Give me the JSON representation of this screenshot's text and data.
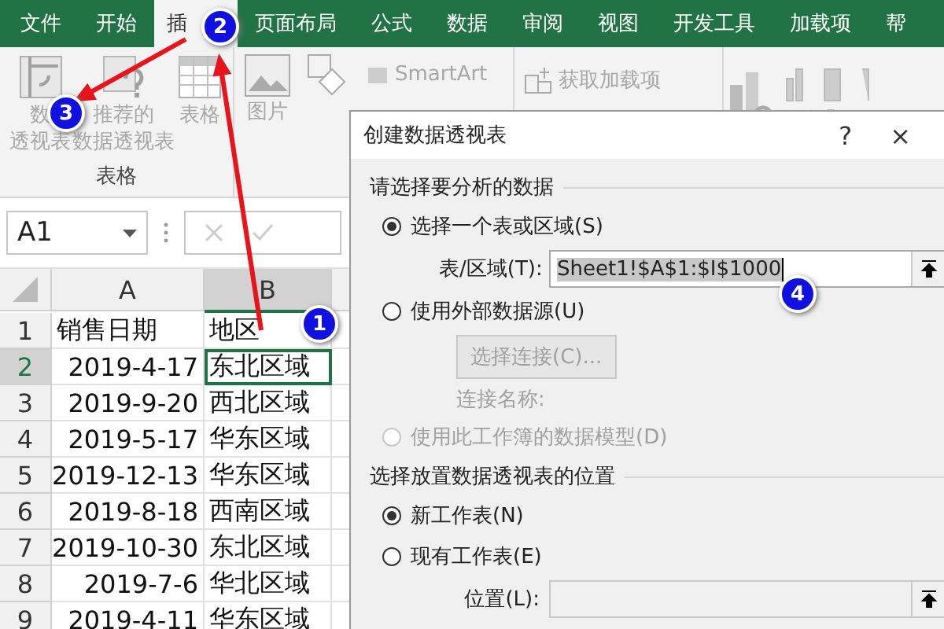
{
  "tabs": [
    {
      "label": "文件",
      "selected": false
    },
    {
      "label": "开始",
      "selected": false
    },
    {
      "label": "插",
      "selected": true
    },
    {
      "label": "页面布局",
      "selected": false
    },
    {
      "label": "公式",
      "selected": false
    },
    {
      "label": "数据",
      "selected": false
    },
    {
      "label": "审阅",
      "selected": false
    },
    {
      "label": "视图",
      "selected": false
    },
    {
      "label": "开发工具",
      "selected": false
    },
    {
      "label": "加载项",
      "selected": false
    },
    {
      "label": "帮",
      "selected": false
    }
  ],
  "ribbon": {
    "table_group": {
      "label": "表格",
      "buttons": [
        {
          "kind": "pivot",
          "lines": [
            "数",
            "透视表"
          ]
        },
        {
          "kind": "recommend",
          "lines": [
            "推荐的",
            "数据透视表"
          ]
        },
        {
          "kind": "table",
          "lines": [
            "表格"
          ]
        }
      ]
    },
    "picture": {
      "label": "图片"
    },
    "smartart": "SmartArt",
    "addins": "获取加载项"
  },
  "name_box": "A1",
  "columns": [
    "A",
    "B"
  ],
  "rows": [
    {
      "num": "1",
      "cells": [
        "销售日期",
        "地区"
      ],
      "selected": false
    },
    {
      "num": "2",
      "cells": [
        "2019-4-17",
        "东北区域"
      ],
      "selected": true
    },
    {
      "num": "3",
      "cells": [
        "2019-9-20",
        "西北区域"
      ],
      "selected": false
    },
    {
      "num": "4",
      "cells": [
        "2019-5-17",
        "华东区域"
      ],
      "selected": false
    },
    {
      "num": "5",
      "cells": [
        "2019-12-13",
        "华东区域"
      ],
      "selected": false
    },
    {
      "num": "6",
      "cells": [
        "2019-8-18",
        "西南区域"
      ],
      "selected": false
    },
    {
      "num": "7",
      "cells": [
        "2019-10-30",
        "东北区域"
      ],
      "selected": false
    },
    {
      "num": "8",
      "cells": [
        "2019-7-6",
        "华北区域"
      ],
      "selected": false
    },
    {
      "num": "9",
      "cells": [
        "2019-4-11",
        "华东区域"
      ],
      "selected": false
    }
  ],
  "dialog": {
    "title": "创建数据透视表",
    "help": "?",
    "close": "×",
    "items": [
      {
        "kind": "section",
        "label": "请选择要分析的数据"
      },
      {
        "kind": "radio",
        "label": "选择一个表或区域(S)",
        "selected": true,
        "disabled": false
      },
      {
        "kind": "field",
        "label": "表/区域(T):",
        "value": "Sheet1!$A$1:$I$1000",
        "disabled": false
      },
      {
        "kind": "radio",
        "label": "使用外部数据源(U)",
        "selected": false,
        "disabled": false
      },
      {
        "kind": "button",
        "label": "选择连接(C)...",
        "disabled": true
      },
      {
        "kind": "note",
        "label": "连接名称:",
        "disabled": true
      },
      {
        "kind": "radio",
        "label": "使用此工作簿的数据模型(D)",
        "selected": false,
        "disabled": true
      },
      {
        "kind": "section",
        "label": "选择放置数据透视表的位置"
      },
      {
        "kind": "radio",
        "label": "新工作表(N)",
        "selected": true,
        "disabled": false
      },
      {
        "kind": "radio",
        "label": "现有工作表(E)",
        "selected": false,
        "disabled": false
      },
      {
        "kind": "field",
        "label": "位置(L):",
        "value": "",
        "disabled": true
      }
    ]
  },
  "steps": [
    "1",
    "2",
    "3",
    "4"
  ]
}
